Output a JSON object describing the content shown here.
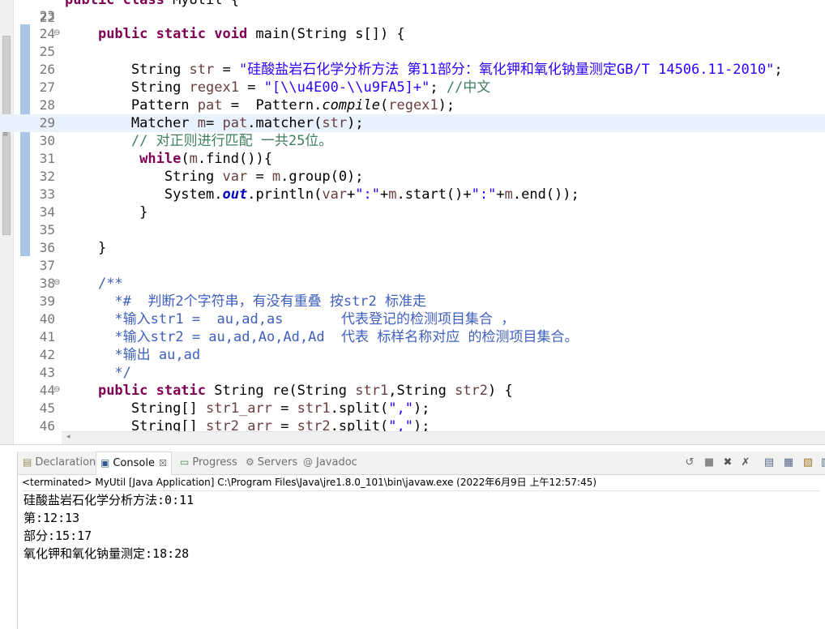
{
  "editor": {
    "top_partial": {
      "num": "22",
      "text": "public class MyUtil {"
    },
    "lines": [
      {
        "num": "23"
      },
      {
        "num": "24",
        "fold": "⊖",
        "kw1": "public static void",
        "t1": " main(String s[]) {"
      },
      {
        "num": "25"
      },
      {
        "num": "26",
        "t1": "String ",
        "var": "str",
        "t2": " = ",
        "str": "\"硅酸盐岩石化学分析方法 第11部分：氧化钾和氧化钠量测定GB/T 14506.11-2010\"",
        "t3": ";"
      },
      {
        "num": "27",
        "t1": "String ",
        "var": "regex1",
        "t2": " = ",
        "str": "\"[\\\\u4E00-\\\\u9FA5]+\"",
        "t3": "; ",
        "cm": "//中文"
      },
      {
        "num": "28",
        "t1": "Pattern ",
        "var": "pat",
        "t2": " =  Pattern.",
        "ital": "compile",
        "t3": "(",
        "var2": "regex1",
        "t4": ");"
      },
      {
        "num": "29",
        "t1": "Matcher ",
        "var": "m",
        "t2": "= ",
        "var2": "pat",
        "t3": ".matcher(",
        "var3": "str",
        "t4": ");"
      },
      {
        "num": "30",
        "cm": "// 对正则进行匹配 一共25位。"
      },
      {
        "num": "31",
        "kw1": "while",
        "t1": "(",
        "var": "m",
        "t2": ".find()){"
      },
      {
        "num": "32",
        "t1": "String ",
        "var": "var",
        "t2": " = ",
        "var2": "m",
        "t3": ".group(0);"
      },
      {
        "num": "33",
        "t1": "System.",
        "fld": "out",
        "t2": ".println(",
        "var": "var",
        "t3": "+",
        "str": "\":\"",
        "t4": "+",
        "var2": "m",
        "t5": ".start()+",
        "str2": "\":\"",
        "t6": "+",
        "var3": "m",
        "t7": ".end());"
      },
      {
        "num": "34",
        "t1": "}"
      },
      {
        "num": "35"
      },
      {
        "num": "36",
        "t1": "}"
      },
      {
        "num": "37"
      },
      {
        "num": "38",
        "fold": "⊖",
        "jd": "/**"
      },
      {
        "num": "39",
        "jd": " *#  判断2个字符串，有没有重叠 按str2 标准走"
      },
      {
        "num": "40",
        "jd": " *输入str1 =  au,ad,as       代表登记的检测项目集合 ，"
      },
      {
        "num": "41",
        "jd": " *输入str2 = au,ad,Ao,Ad,Ad  代表 标样名称对应 的检测项目集合。"
      },
      {
        "num": "42",
        "jd": " *输出 au,ad"
      },
      {
        "num": "43",
        "jd": " */"
      },
      {
        "num": "44",
        "fold": "⊖",
        "kw1": "public static",
        "t1": " String re(String ",
        "var": "str1",
        "t2": ",String ",
        "var2": "str2",
        "t3": ") {"
      },
      {
        "num": "45",
        "t1": "String[] ",
        "var": "str1_arr",
        "t2": " = ",
        "var2": "str1",
        "t3": ".split(",
        "str": "\",\"",
        "t4": ");"
      },
      {
        "num": "46",
        "t1": "String[] ",
        "var": "str2_arr",
        "t2": " = ",
        "var2": "str2",
        "t3": ".split(",
        "str": "\",\"",
        "t4": ");"
      }
    ]
  },
  "panel": {
    "tabs": [
      {
        "label": "Declaration",
        "icon": "declaration-icon"
      },
      {
        "label": "Console",
        "icon": "console-icon"
      },
      {
        "label": "Progress",
        "icon": "progress-icon"
      },
      {
        "label": "Servers",
        "icon": "servers-icon"
      },
      {
        "label": "Javadoc",
        "icon": "javadoc-icon"
      }
    ],
    "terminated_line": "<terminated> MyUtil [Java Application] C:\\Program Files\\Java\\jre1.8.0_101\\bin\\javaw.exe (2022年6月9日 上午12:57:45)",
    "output": [
      "硅酸盐岩石化学分析方法:0:11",
      "第:12:13",
      "部分:15:17",
      "氧化钾和氧化钠量测定:18:28"
    ]
  }
}
